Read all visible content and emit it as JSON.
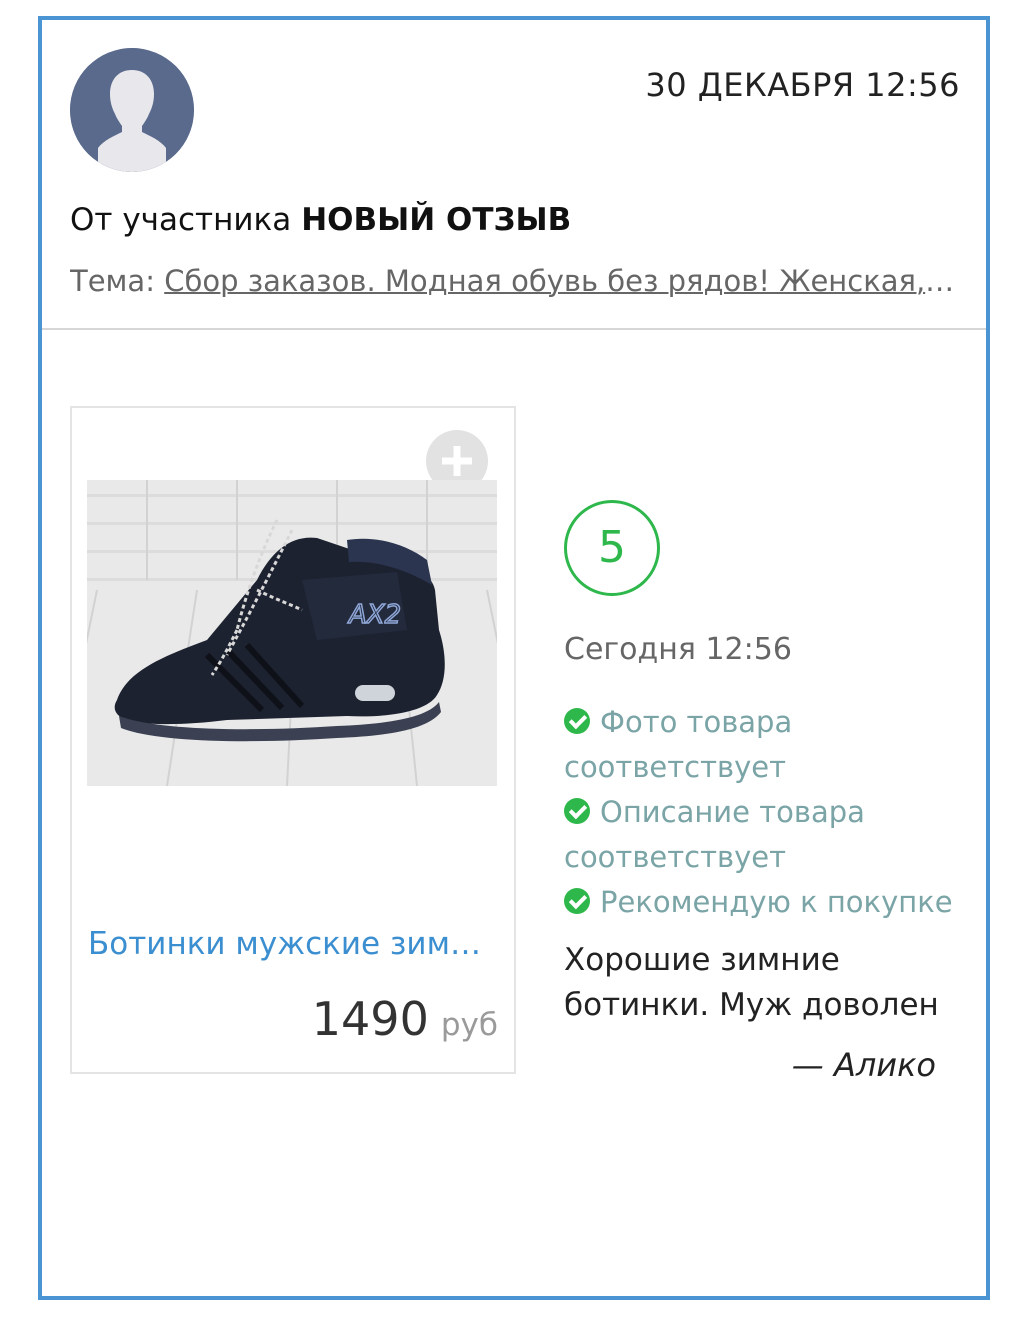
{
  "header": {
    "datetime": "30 ДЕКАБРЯ 12:56",
    "from_prefix": "От участника",
    "from_name": "НОВЫЙ ОТЗЫВ",
    "topic_label": "Тема:",
    "topic_link": "Сбор заказов. Модная обувь без рядов! Женская, мужская, детская обувь"
  },
  "product": {
    "name": "Ботинки мужские зимние",
    "price": "1490",
    "currency": "руб",
    "image_icon": "shoe-photo"
  },
  "review": {
    "rating": "5",
    "time": "Сегодня 12:56",
    "checks": [
      "Фото товара соответствует",
      "Описание товара соответствует",
      "Рекомендую к покупке"
    ],
    "text": "Хорошие зимние ботинки. Муж доволен",
    "author": "— Алико"
  },
  "colors": {
    "frame": "#4b94d4",
    "link": "#3b8fd0",
    "accent_green": "#2eb84b"
  }
}
